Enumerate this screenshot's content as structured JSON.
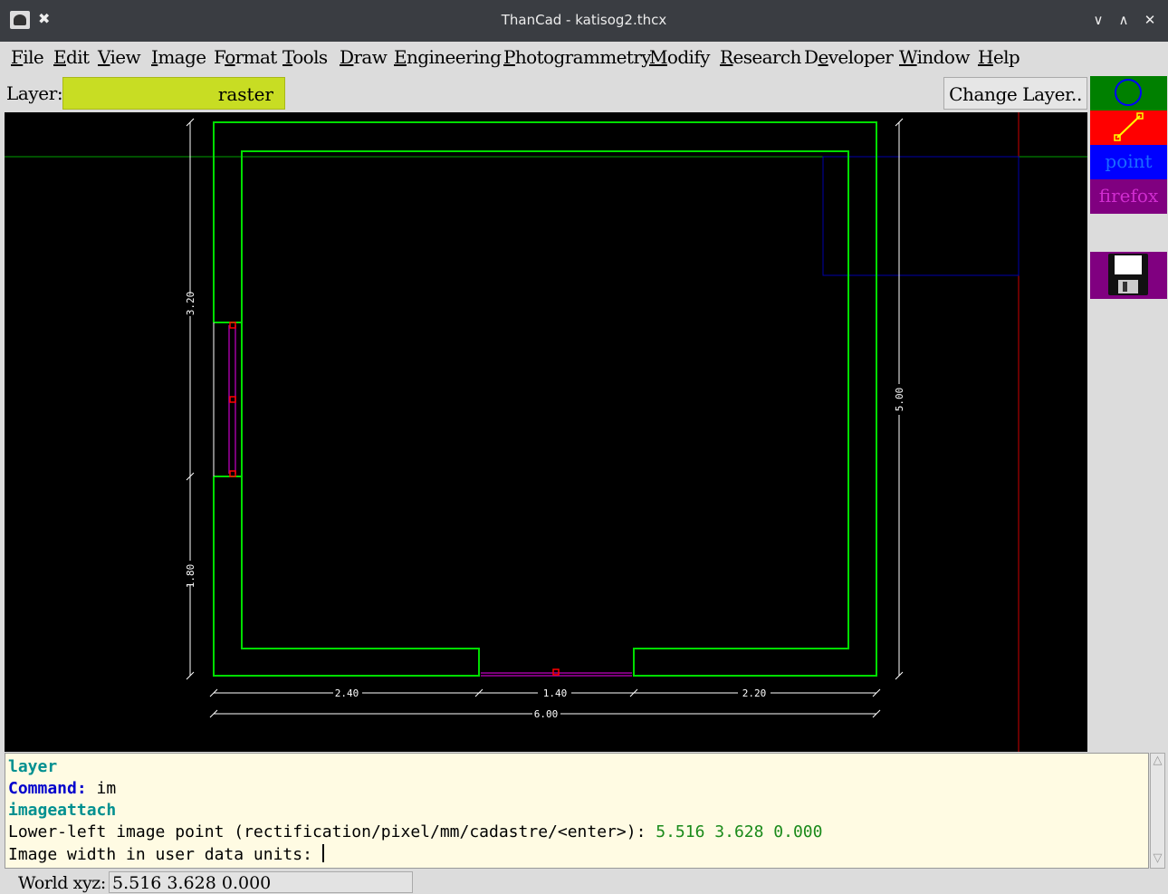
{
  "window": {
    "title": "ThanCad - katisog2.thcx",
    "app_icon": "thancad-logo-icon",
    "controls": [
      "minimize-icon",
      "maximize-icon",
      "close-icon"
    ]
  },
  "menu": [
    {
      "label": "File"
    },
    {
      "label": "Edit"
    },
    {
      "label": "View"
    },
    {
      "label": "Image"
    },
    {
      "label": "Format"
    },
    {
      "label": "Tools"
    },
    {
      "label": "Draw"
    },
    {
      "label": "Engineering"
    },
    {
      "label": "Photogrammetry"
    },
    {
      "label": "Modify"
    },
    {
      "label": "Research"
    },
    {
      "label": "Developer"
    },
    {
      "label": "Window"
    },
    {
      "label": "Help"
    }
  ],
  "layerbar": {
    "label": "Layer:",
    "current_layer": "raster",
    "layer_color": "#c8dd23",
    "change_button": "Change Layer.."
  },
  "palette": {
    "circle_tool": {
      "icon": "circle-icon",
      "color": "#008000"
    },
    "line_tool": {
      "icon": "line-icon",
      "color": "#ff0000"
    },
    "point_tool": {
      "label": "point",
      "color": "#0000ff"
    },
    "firefox_tool": {
      "label": "firefox",
      "color": "#800080"
    },
    "save_tool": {
      "icon": "floppy-disk-icon",
      "color": "#800080"
    }
  },
  "drawing": {
    "dimensions": {
      "left_upper": "3.20",
      "left_lower": "1.80",
      "right": "5.00",
      "bottom_left": "2.40",
      "bottom_mid": "1.40",
      "bottom_right": "2.20",
      "bottom_total": "6.00"
    },
    "colors": {
      "walls": "#00dd00",
      "openings": "#a000a0",
      "markers": "#ff0000",
      "dimensions": "#ffffff",
      "crosshair_h": "#00a000",
      "crosshair_v": "#cc0000",
      "selection_box": "#0000aa"
    }
  },
  "command": {
    "lines": [
      {
        "text": "layer",
        "style": "cmd"
      },
      {
        "prompt": "Command:",
        "text": " im"
      },
      {
        "text": "imageattach",
        "style": "cmd"
      },
      {
        "prompt_plain": "Lower-left image point (rectification/pixel/mm/cadastre/<enter>): ",
        "value": "5.516 3.628 0.000"
      },
      {
        "prompt_plain": "Image width in user data units: "
      }
    ]
  },
  "status": {
    "label": "World xyz:",
    "value": "5.516 3.628 0.000"
  }
}
